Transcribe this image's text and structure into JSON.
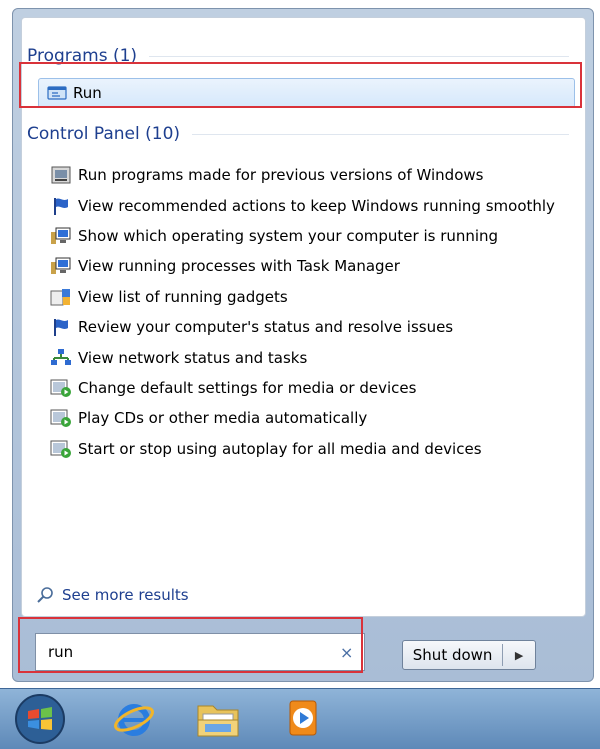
{
  "programs": {
    "header": "Programs (1)",
    "items": [
      {
        "label": "Run",
        "icon": "run-icon"
      }
    ]
  },
  "control_panel": {
    "header": "Control Panel (10)",
    "items": [
      {
        "label": "Run programs made for previous versions of Windows",
        "icon": "compatibility-icon"
      },
      {
        "label": "View recommended actions to keep Windows running smoothly",
        "icon": "action-center-flag-icon"
      },
      {
        "label": "Show which operating system your computer is running",
        "icon": "system-computer-icon"
      },
      {
        "label": "View running processes with Task Manager",
        "icon": "system-computer-icon"
      },
      {
        "label": "View list of running gadgets",
        "icon": "gadgets-icon"
      },
      {
        "label": "Review your computer's status and resolve issues",
        "icon": "action-center-flag-icon"
      },
      {
        "label": "View network status and tasks",
        "icon": "network-icon"
      },
      {
        "label": "Change default settings for media or devices",
        "icon": "autoplay-icon"
      },
      {
        "label": "Play CDs or other media automatically",
        "icon": "autoplay-icon"
      },
      {
        "label": "Start or stop using autoplay for all media and devices",
        "icon": "autoplay-icon"
      }
    ]
  },
  "more_results": "See more results",
  "search": {
    "value": "run",
    "clear_icon": "×"
  },
  "shutdown": {
    "label": "Shut down",
    "arrow": "▶"
  },
  "taskbar": {
    "items": [
      "start-orb-icon",
      "internet-explorer-icon",
      "windows-explorer-icon",
      "media-player-icon"
    ]
  },
  "colors": {
    "accent": "#1e3f8f",
    "highlight": "#d9323a",
    "selection": "#d6e8fb"
  }
}
